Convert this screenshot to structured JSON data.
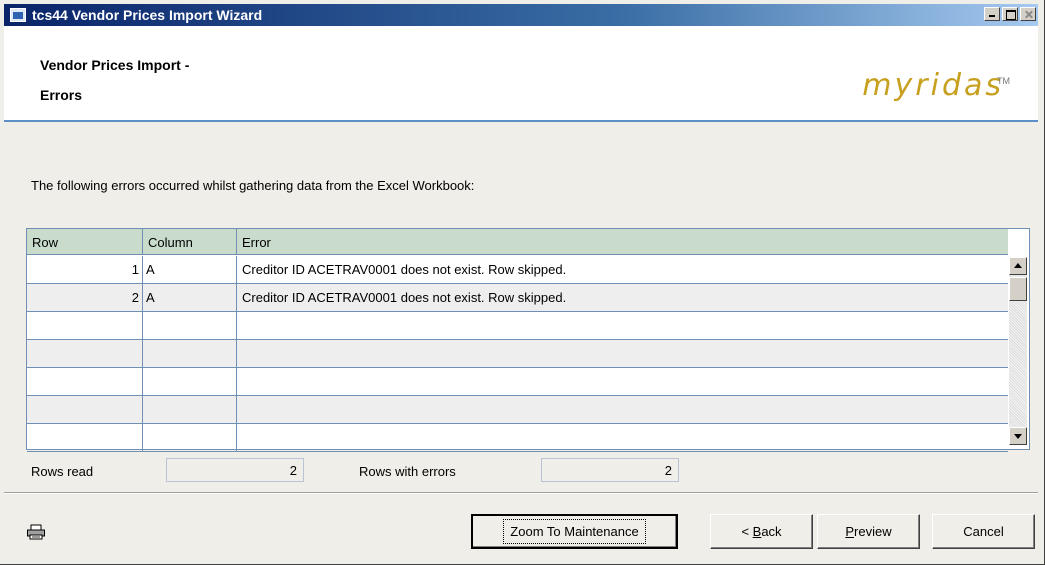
{
  "window": {
    "title": "tcs44 Vendor Prices Import Wizard"
  },
  "header": {
    "title_line1": "Vendor Prices Import -",
    "title_line2": "Errors",
    "logo": "myridas",
    "logo_tm": "TM"
  },
  "intro": "The following errors occurred whilst gathering data from the Excel Workbook:",
  "grid": {
    "columns": [
      "Row",
      "Column",
      "Error"
    ],
    "rows": [
      {
        "row": "1",
        "column": "A",
        "error": "Creditor ID ACETRAV0001 does not exist. Row skipped."
      },
      {
        "row": "2",
        "column": "A",
        "error": "Creditor ID ACETRAV0001 does not exist. Row skipped."
      },
      {
        "row": "",
        "column": "",
        "error": ""
      },
      {
        "row": "",
        "column": "",
        "error": ""
      },
      {
        "row": "",
        "column": "",
        "error": ""
      },
      {
        "row": "",
        "column": "",
        "error": ""
      },
      {
        "row": "",
        "column": "",
        "error": ""
      }
    ]
  },
  "summary": {
    "rows_read_label": "Rows read",
    "rows_read_value": "2",
    "rows_errors_label": "Rows with errors",
    "rows_errors_value": "2"
  },
  "buttons": {
    "zoom_label": "Zoom To Maintenance",
    "back_mnemonic": "B",
    "back_rest": "ack",
    "back_prefix": "< ",
    "preview_mnemonic": "P",
    "preview_rest": "review",
    "cancel_label": "Cancel"
  },
  "icons": {
    "printer": "printer-icon"
  },
  "colors": {
    "title_bar": "#0a246a",
    "grid_header": "#c9dccb",
    "grid_lines": "#6f8fb5",
    "logo": "#c8a020"
  }
}
